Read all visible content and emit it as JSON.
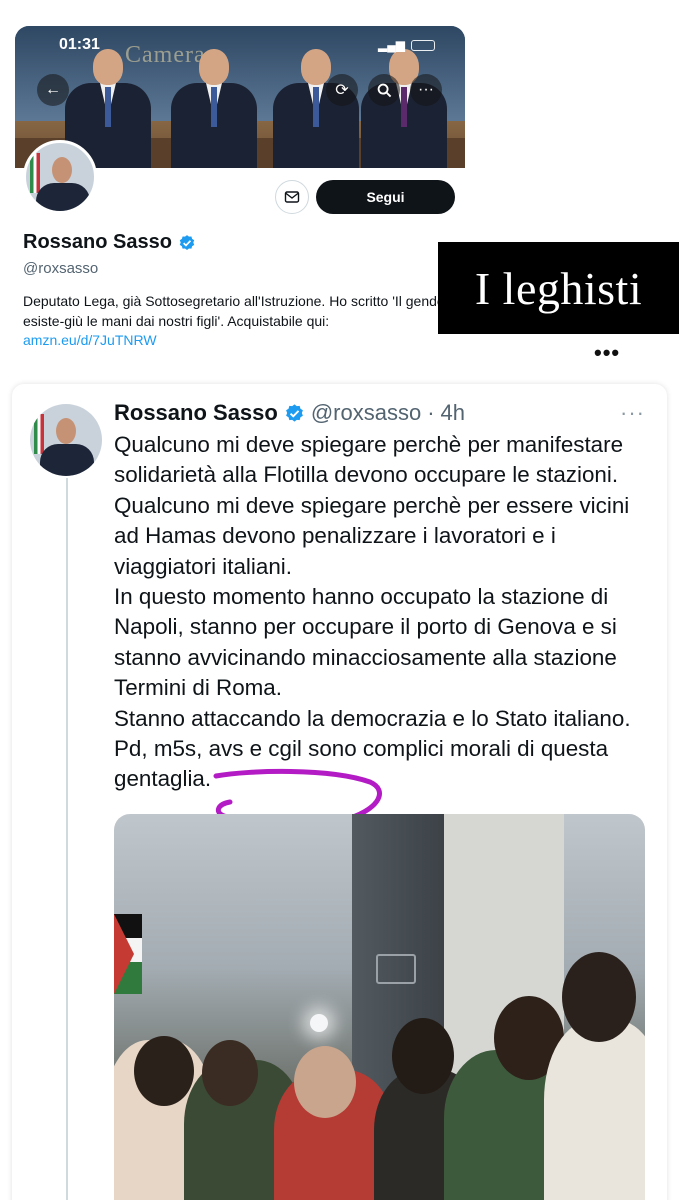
{
  "status_bar": {
    "time": "01:31"
  },
  "banner": {
    "text": "Camera"
  },
  "profile": {
    "name": "Rossano Sasso",
    "handle": "@roxsasso",
    "bio_text": "Deputato Lega, già Sottosegretario all'Istruzione. Ho scritto 'Il gender esiste-giù le mani dai nostri figli'. Acquistabile qui: ",
    "bio_link": "amzn.eu/d/7JuTNRW",
    "follow_label": "Segui"
  },
  "caption": {
    "text": "I leghisti"
  },
  "tweet": {
    "name": "Rossano Sasso",
    "handle": "@roxsasso",
    "separator": "·",
    "time": "4h",
    "paragraphs": [
      "Qualcuno mi deve spiegare perchè per manifestare solidarietà alla Flotilla devono occupare le stazioni. Qualcuno mi deve spiegare perchè per essere vicini ad Hamas devono penalizzare i lavoratori e i viaggiatori italiani.",
      "In questo momento hanno occupato la stazione di Napoli, stanno per occupare il porto di Genova e si stanno avvicinando minacciosamente alla stazione Termini di Roma.",
      "Stanno attaccando la democrazia e lo Stato italiano. Pd, m5s, avs e cgil sono complici morali di questa gentaglia."
    ]
  },
  "colors": {
    "link": "#1d9bf0",
    "verified": "#1d9bf0",
    "scribble": "#b31cc4",
    "follow_bg": "#0f1419"
  },
  "icons": [
    "back-arrow-icon",
    "refresh-icon",
    "search-icon",
    "more-icon",
    "mail-icon",
    "verified-icon",
    "ellipsis-icon"
  ]
}
